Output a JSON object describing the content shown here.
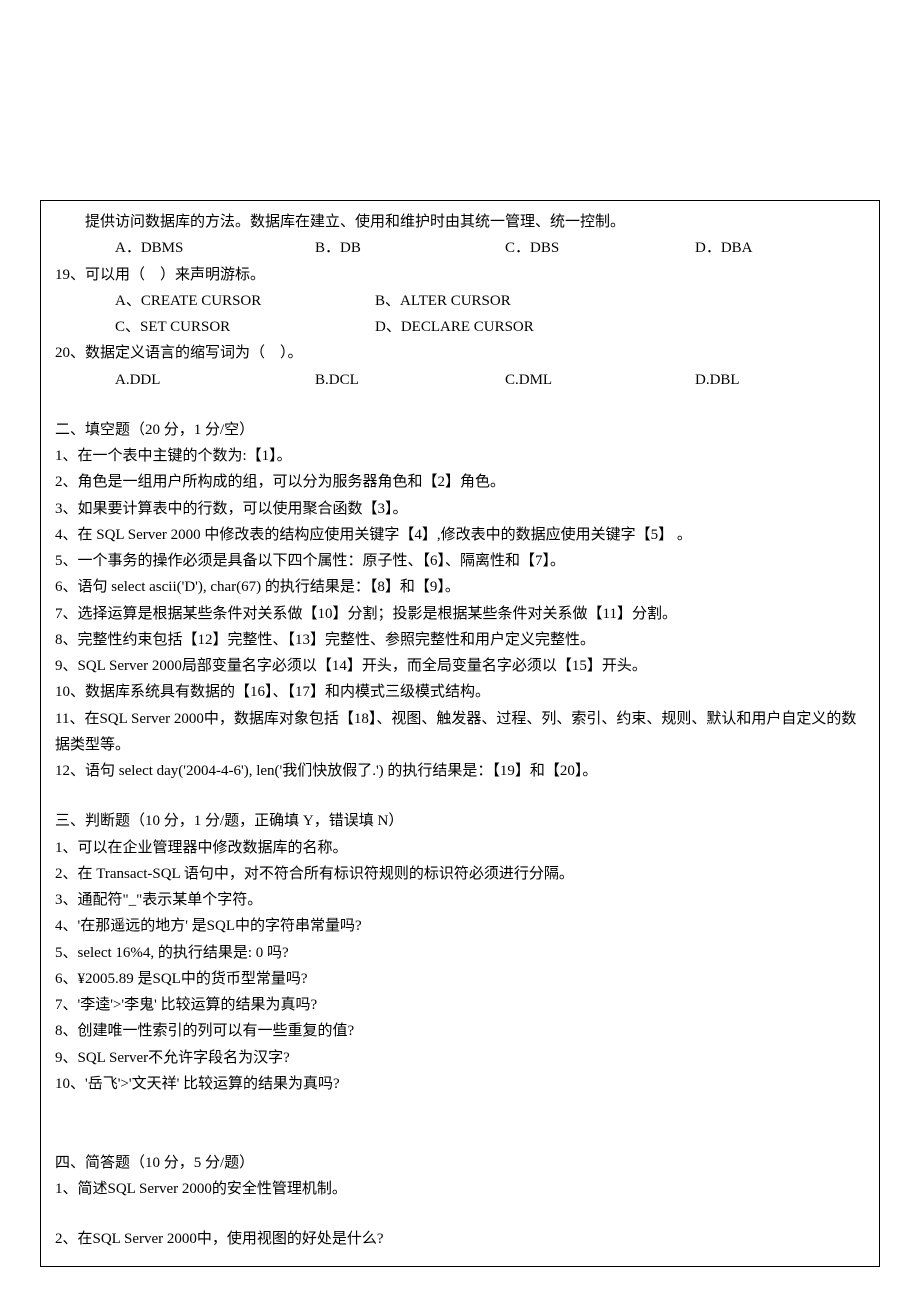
{
  "intro": "提供访问数据库的方法。数据库在建立、使用和维护时由其统一管理、统一控制。",
  "q18opts": {
    "a": "A．DBMS",
    "b": "B．DB",
    "c": "C．DBS",
    "d": "D．DBA"
  },
  "q19": "19、可以用（　）来声明游标。",
  "q19opts": {
    "a": "A、CREATE CURSOR",
    "b": "B、ALTER CURSOR",
    "c": "C、SET CURSOR",
    "d": "D、DECLARE CURSOR"
  },
  "q20": "20、数据定义语言的缩写词为（　）。",
  "q20opts": {
    "a": "A.DDL",
    "b": "B.DCL",
    "c": "C.DML",
    "d": "D.DBL"
  },
  "s2": {
    "title": "二、填空题（20 分，1 分/空）",
    "items": [
      "1、在一个表中主键的个数为:【1】。",
      "2、角色是一组用户所构成的组，可以分为服务器角色和【2】角色。",
      "3、如果要计算表中的行数，可以使用聚合函数【3】。",
      "4、在 SQL Server 2000 中修改表的结构应使用关键字【4】,修改表中的数据应使用关键字【5】 。",
      "5、一个事务的操作必须是具备以下四个属性：原子性、【6】、隔离性和【7】。",
      "6、语句 select ascii('D'), char(67) 的执行结果是：【8】和【9】。",
      "7、选择运算是根据某些条件对关系做【10】分割；投影是根据某些条件对关系做【11】分割。",
      "8、完整性约束包括【12】完整性、【13】完整性、参照完整性和用户定义完整性。",
      "9、SQL Server 2000局部变量名字必须以【14】开头，而全局变量名字必须以【15】开头。",
      "10、数据库系统具有数据的【16】、【17】和内模式三级模式结构。",
      "11、在SQL Server 2000中，数据库对象包括【18】、视图、触发器、过程、列、索引、约束、规则、默认和用户自定义的数据类型等。",
      "12、语句 select day('2004-4-6'), len('我们快放假了.') 的执行结果是：【19】和【20】。"
    ]
  },
  "s3": {
    "title": "三、判断题（10 分，1 分/题，正确填 Y，错误填 N）",
    "items": [
      "1、可以在企业管理器中修改数据库的名称。",
      "2、在 Transact-SQL 语句中，对不符合所有标识符规则的标识符必须进行分隔。",
      "3、通配符\"_\"表示某单个字符。",
      "4、'在那遥远的地方' 是SQL中的字符串常量吗?",
      "5、select 16%4, 的执行结果是: 0 吗?",
      "6、¥2005.89 是SQL中的货币型常量吗?",
      "7、'李逵'>'李鬼' 比较运算的结果为真吗?",
      "8、创建唯一性索引的列可以有一些重复的值?",
      "9、SQL Server不允许字段名为汉字?",
      "10、'岳飞'>'文天祥' 比较运算的结果为真吗?"
    ]
  },
  "s4": {
    "title": "四、简答题（10 分，5 分/题）",
    "items": [
      " 1、简述SQL Server 2000的安全性管理机制。",
      " 2、在SQL Server 2000中，使用视图的好处是什么?"
    ]
  }
}
